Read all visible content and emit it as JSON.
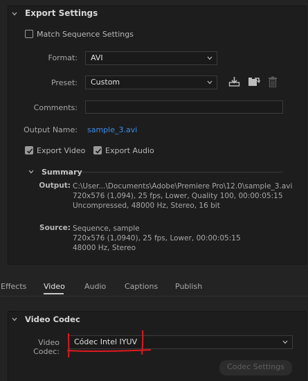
{
  "export_settings": {
    "title": "Export Settings",
    "match_sequence_label": "Match Sequence Settings",
    "match_sequence_checked": false,
    "format_label": "Format:",
    "format_value": "AVI",
    "preset_label": "Preset:",
    "preset_value": "Custom",
    "comments_label": "Comments:",
    "comments_value": "",
    "output_name_label": "Output Name:",
    "output_name_value": "sample_3.avi",
    "export_video_label": "Export Video",
    "export_video_checked": true,
    "export_audio_label": "Export Audio",
    "export_audio_checked": true,
    "icons": [
      "save-preset-icon",
      "import-preset-icon",
      "delete-preset-icon"
    ]
  },
  "summary": {
    "title": "Summary",
    "output_label": "Output:",
    "output_lines": [
      "C:\\User...\\Documents\\Adobe\\Premiere Pro\\12.0\\sample_3.avi",
      "720x576 (1,094), 25 fps, Lower, Quality 100, 00:00:05:15",
      "Uncompressed, 48000 Hz, Stereo, 16 bit"
    ],
    "source_label": "Source:",
    "source_lines": [
      "Sequence, sample",
      "720x576 (1,0940), 25 fps, Lower, 00:00:05:15",
      "48000 Hz, Stereo"
    ]
  },
  "tabs": {
    "items": [
      "Effects",
      "Video",
      "Audio",
      "Captions",
      "Publish"
    ],
    "active": "Video"
  },
  "video_codec": {
    "title": "Video Codec",
    "codec_label": "Video Codec:",
    "codec_value": "Códec Intel IYUV",
    "codec_settings_button": "Codec Settings"
  },
  "colors": {
    "background": "#232323",
    "panel": "#1d1d1d",
    "link": "#3b8eea",
    "annotation": "#e0191f"
  }
}
